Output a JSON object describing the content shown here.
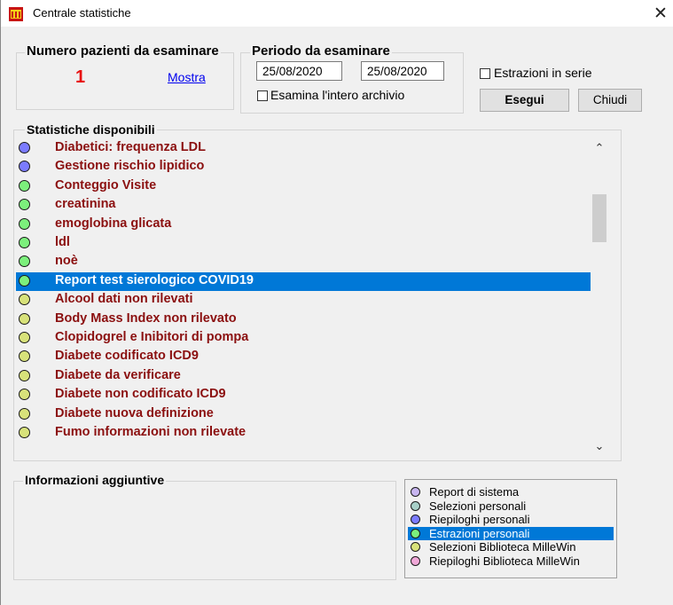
{
  "window": {
    "title": "Centrale statistiche",
    "close_glyph": "✕"
  },
  "patients": {
    "legend": "Numero pazienti da esaminare",
    "count": "1",
    "show_link": "Mostra"
  },
  "period": {
    "legend": "Periodo da esaminare",
    "from_date": "25/08/2020",
    "to_date": "25/08/2020",
    "whole_archive_label": "Esamina l'intero archivio",
    "whole_archive_checked": false
  },
  "actions": {
    "batch_label": "Estrazioni in serie",
    "batch_checked": false,
    "run_label": "Esegui",
    "close_label": "Chiudi"
  },
  "stats": {
    "legend": "Statistiche disponibili",
    "items": [
      {
        "label": "Diabetici: frequenza LDL",
        "color": "#7b7bff",
        "selected": false
      },
      {
        "label": "Gestione rischio lipidico",
        "color": "#7b7bff",
        "selected": false
      },
      {
        "label": "Conteggio Visite",
        "color": "#7cf07c",
        "selected": false
      },
      {
        "label": "creatinina",
        "color": "#7cf07c",
        "selected": false
      },
      {
        "label": "emoglobina glicata",
        "color": "#7cf07c",
        "selected": false
      },
      {
        "label": "ldl",
        "color": "#7cf07c",
        "selected": false
      },
      {
        "label": "noè",
        "color": "#7cf07c",
        "selected": false
      },
      {
        "label": "Report test sierologico COVID19",
        "color": "#7cf07c",
        "selected": true
      },
      {
        "label": "Alcool dati non rilevati",
        "color": "#d8e27a",
        "selected": false
      },
      {
        "label": "Body Mass Index non rilevato",
        "color": "#d8e27a",
        "selected": false
      },
      {
        "label": "Clopidogrel e Inibitori di pompa",
        "color": "#d8e27a",
        "selected": false
      },
      {
        "label": "Diabete codificato ICD9",
        "color": "#d8e27a",
        "selected": false
      },
      {
        "label": "Diabete da verificare",
        "color": "#d8e27a",
        "selected": false
      },
      {
        "label": "Diabete non codificato ICD9",
        "color": "#d8e27a",
        "selected": false
      },
      {
        "label": "Diabete nuova definizione",
        "color": "#d8e27a",
        "selected": false
      },
      {
        "label": "Fumo informazioni non rilevate",
        "color": "#d8e27a",
        "selected": false
      }
    ],
    "scroll_up": "⌃",
    "scroll_down": "⌄"
  },
  "info": {
    "legend": "Informazioni aggiuntive"
  },
  "color_legend": {
    "items": [
      {
        "label": "Report di sistema",
        "color": "#c7b5f0",
        "selected": false
      },
      {
        "label": "Selezioni personali",
        "color": "#a8d0c8",
        "selected": false
      },
      {
        "label": "Riepiloghi personali",
        "color": "#7b7bff",
        "selected": false
      },
      {
        "label": "Estrazioni personali",
        "color": "#7cf07c",
        "selected": true
      },
      {
        "label": "Selezioni Biblioteca MilleWin",
        "color": "#d8e27a",
        "selected": false
      },
      {
        "label": "Riepiloghi Biblioteca MilleWin",
        "color": "#f0a8d8",
        "selected": false
      }
    ]
  }
}
